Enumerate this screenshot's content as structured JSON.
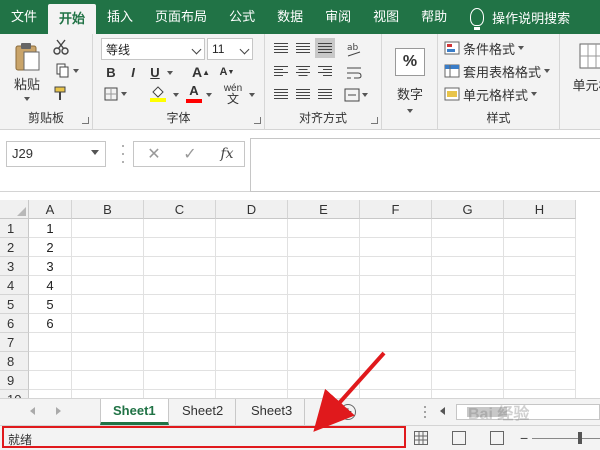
{
  "tabs": [
    {
      "label": "文件"
    },
    {
      "label": "开始"
    },
    {
      "label": "插入"
    },
    {
      "label": "页面布局"
    },
    {
      "label": "公式"
    },
    {
      "label": "数据"
    },
    {
      "label": "审阅"
    },
    {
      "label": "视图"
    },
    {
      "label": "帮助"
    }
  ],
  "tell_me": "操作说明搜索",
  "ribbon": {
    "clipboard": {
      "paste_label": "粘贴",
      "group_label": "剪贴板"
    },
    "font": {
      "font_name": "等线",
      "font_size": "11",
      "bold": "B",
      "italic": "I",
      "underline": "U",
      "grow": "A",
      "shrink": "A",
      "fill_color": "#ffff00",
      "font_color": "#ff0000",
      "phonetic": "wén",
      "group_label": "字体"
    },
    "alignment": {
      "group_label": "对齐方式"
    },
    "number": {
      "button_label": "数字",
      "format_symbol": "%"
    },
    "styles": {
      "conditional": "条件格式",
      "as_table": "套用表格格式",
      "cell_styles": "单元格样式",
      "group_label": "样式"
    },
    "cells": {
      "button_label": "单元格"
    }
  },
  "formula_bar": {
    "name_box": "J29",
    "cancel": "✕",
    "enter": "✓",
    "fx": "fx"
  },
  "grid": {
    "columns": [
      "A",
      "B",
      "C",
      "D",
      "E",
      "F",
      "G",
      "H"
    ],
    "rows": [
      "1",
      "2",
      "3",
      "4",
      "5",
      "6",
      "7",
      "8",
      "9",
      "10"
    ],
    "column_a_values": [
      "1",
      "2",
      "3",
      "4",
      "5",
      "6"
    ]
  },
  "sheets": [
    {
      "name": "Sheet1"
    },
    {
      "name": "Sheet2"
    },
    {
      "name": "Sheet3"
    }
  ],
  "add_sheet": "+",
  "status": {
    "text": "就绪"
  },
  "watermark": "Bai 经验",
  "colors": {
    "accent": "#217346",
    "highlight": "#e0191c"
  }
}
